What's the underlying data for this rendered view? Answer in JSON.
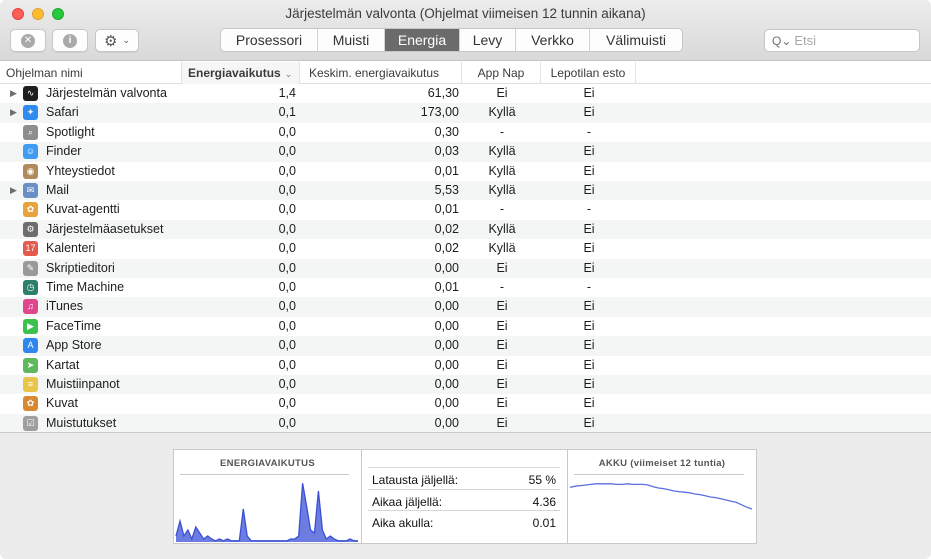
{
  "window": {
    "title": "Järjestelmän valvonta (Ohjelmat viimeisen 12 tunnin aikana)"
  },
  "toolbar": {
    "stop_icon": "x-circle-icon",
    "info_icon": "info-circle-icon",
    "gear_icon": "gear-icon",
    "tabs": [
      {
        "label": "Prosessori",
        "active": false
      },
      {
        "label": "Muisti",
        "active": false
      },
      {
        "label": "Energia",
        "active": true
      },
      {
        "label": "Levy",
        "active": false
      },
      {
        "label": "Verkko",
        "active": false
      },
      {
        "label": "Välimuisti",
        "active": false
      }
    ],
    "search_placeholder": "Etsi"
  },
  "table": {
    "headers": {
      "name": "Ohjelman nimi",
      "energy": "Energiavaikutus",
      "avg": "Keskim. energiavaikutus",
      "nap": "App Nap",
      "sleep": "Lepotilan esto"
    },
    "rows": [
      {
        "name": "Järjestelmän valvonta",
        "energy": "1,4",
        "avg": "61,30",
        "nap": "Ei",
        "sleep": "Ei",
        "expandable": true,
        "icon": "activity-monitor-icon",
        "color": "#1f1f1f",
        "glyph": "∿"
      },
      {
        "name": "Safari",
        "energy": "0,1",
        "avg": "173,00",
        "nap": "Kyllä",
        "sleep": "Ei",
        "expandable": true,
        "icon": "safari-icon",
        "color": "#2f8bf0",
        "glyph": "✦"
      },
      {
        "name": "Spotlight",
        "energy": "0,0",
        "avg": "0,30",
        "nap": "-",
        "sleep": "-",
        "expandable": false,
        "icon": "spotlight-icon",
        "color": "#8e8e8e",
        "glyph": "⌕"
      },
      {
        "name": "Finder",
        "energy": "0,0",
        "avg": "0,03",
        "nap": "Kyllä",
        "sleep": "Ei",
        "expandable": false,
        "icon": "finder-icon",
        "color": "#3f9cf2",
        "glyph": "☺"
      },
      {
        "name": "Yhteystiedot",
        "energy": "0,0",
        "avg": "0,01",
        "nap": "Kyllä",
        "sleep": "Ei",
        "expandable": false,
        "icon": "contacts-icon",
        "color": "#b08a5a",
        "glyph": "◉"
      },
      {
        "name": "Mail",
        "energy": "0,0",
        "avg": "5,53",
        "nap": "Kyllä",
        "sleep": "Ei",
        "expandable": true,
        "icon": "mail-icon",
        "color": "#6a8fc4",
        "glyph": "✉"
      },
      {
        "name": "Kuvat-agentti",
        "energy": "0,0",
        "avg": "0,01",
        "nap": "-",
        "sleep": "-",
        "expandable": false,
        "icon": "photos-agent-icon",
        "color": "#e8a33c",
        "glyph": "✿"
      },
      {
        "name": "Järjestelmäasetukset",
        "energy": "0,0",
        "avg": "0,02",
        "nap": "Kyllä",
        "sleep": "Ei",
        "expandable": false,
        "icon": "system-preferences-icon",
        "color": "#6d6d6d",
        "glyph": "⚙"
      },
      {
        "name": "Kalenteri",
        "energy": "0,0",
        "avg": "0,02",
        "nap": "Kyllä",
        "sleep": "Ei",
        "expandable": false,
        "icon": "calendar-icon",
        "color": "#e35a4f",
        "glyph": "17"
      },
      {
        "name": "Skriptieditori",
        "energy": "0,0",
        "avg": "0,00",
        "nap": "Ei",
        "sleep": "Ei",
        "expandable": false,
        "icon": "script-editor-icon",
        "color": "#9a9a9a",
        "glyph": "✎"
      },
      {
        "name": "Time Machine",
        "energy": "0,0",
        "avg": "0,01",
        "nap": "-",
        "sleep": "-",
        "expandable": false,
        "icon": "time-machine-icon",
        "color": "#2c7f6c",
        "glyph": "◷"
      },
      {
        "name": "iTunes",
        "energy": "0,0",
        "avg": "0,00",
        "nap": "Ei",
        "sleep": "Ei",
        "expandable": false,
        "icon": "itunes-icon",
        "color": "#e0468c",
        "glyph": "♫"
      },
      {
        "name": "FaceTime",
        "energy": "0,0",
        "avg": "0,00",
        "nap": "Ei",
        "sleep": "Ei",
        "expandable": false,
        "icon": "facetime-icon",
        "color": "#3cc24c",
        "glyph": "▶"
      },
      {
        "name": "App Store",
        "energy": "0,0",
        "avg": "0,00",
        "nap": "Ei",
        "sleep": "Ei",
        "expandable": false,
        "icon": "app-store-icon",
        "color": "#2d87ef",
        "glyph": "A"
      },
      {
        "name": "Kartat",
        "energy": "0,0",
        "avg": "0,00",
        "nap": "Ei",
        "sleep": "Ei",
        "expandable": false,
        "icon": "maps-icon",
        "color": "#5fb85c",
        "glyph": "➤"
      },
      {
        "name": "Muistiinpanot",
        "energy": "0,0",
        "avg": "0,00",
        "nap": "Ei",
        "sleep": "Ei",
        "expandable": false,
        "icon": "notes-icon",
        "color": "#e9c54a",
        "glyph": "≡"
      },
      {
        "name": "Kuvat",
        "energy": "0,0",
        "avg": "0,00",
        "nap": "Ei",
        "sleep": "Ei",
        "expandable": false,
        "icon": "photos-icon",
        "color": "#d9892f",
        "glyph": "✿"
      },
      {
        "name": "Muistutukset",
        "energy": "0,0",
        "avg": "0,00",
        "nap": "Ei",
        "sleep": "Ei",
        "expandable": false,
        "icon": "reminders-icon",
        "color": "#9f9f9f",
        "glyph": "☑"
      }
    ]
  },
  "bottom": {
    "energy_title": "ENERGIAVAIKUTUS",
    "energy_graph": [
      0.1,
      0.35,
      0.1,
      0.2,
      0.05,
      0.25,
      0.15,
      0.05,
      0.1,
      0.05,
      0.02,
      0.05,
      0.02,
      0.05,
      0.02,
      0.02,
      0.02,
      0.55,
      0.1,
      0.02,
      0.02,
      0.02,
      0.02,
      0.02,
      0.02,
      0.02,
      0.02,
      0.02,
      0.02,
      0.05,
      0.05,
      0.1,
      0.98,
      0.6,
      0.2,
      0.15,
      0.85,
      0.2,
      0.05,
      0.1,
      0.05,
      0.02,
      0.02,
      0.02,
      0.05,
      0.02,
      0.02
    ],
    "stats": [
      {
        "label": "Latausta jäljellä:",
        "value": "55 %"
      },
      {
        "label": "Aikaa jäljellä:",
        "value": "4.36"
      },
      {
        "label": "Aika akulla:",
        "value": "0.01"
      }
    ],
    "battery_title": "AKKU (viimeiset 12 tuntia)",
    "battery_graph": [
      0.91,
      0.93,
      0.94,
      0.95,
      0.96,
      0.97,
      0.97,
      0.97,
      0.97,
      0.96,
      0.96,
      0.97,
      0.96,
      0.96,
      0.96,
      0.95,
      0.92,
      0.9,
      0.89,
      0.87,
      0.85,
      0.84,
      0.83,
      0.82,
      0.8,
      0.79,
      0.77,
      0.75,
      0.74,
      0.72,
      0.7,
      0.68,
      0.66,
      0.62,
      0.58,
      0.55
    ],
    "colors": {
      "energy": "#3b50d6",
      "battery": "#5a6fe0"
    }
  }
}
